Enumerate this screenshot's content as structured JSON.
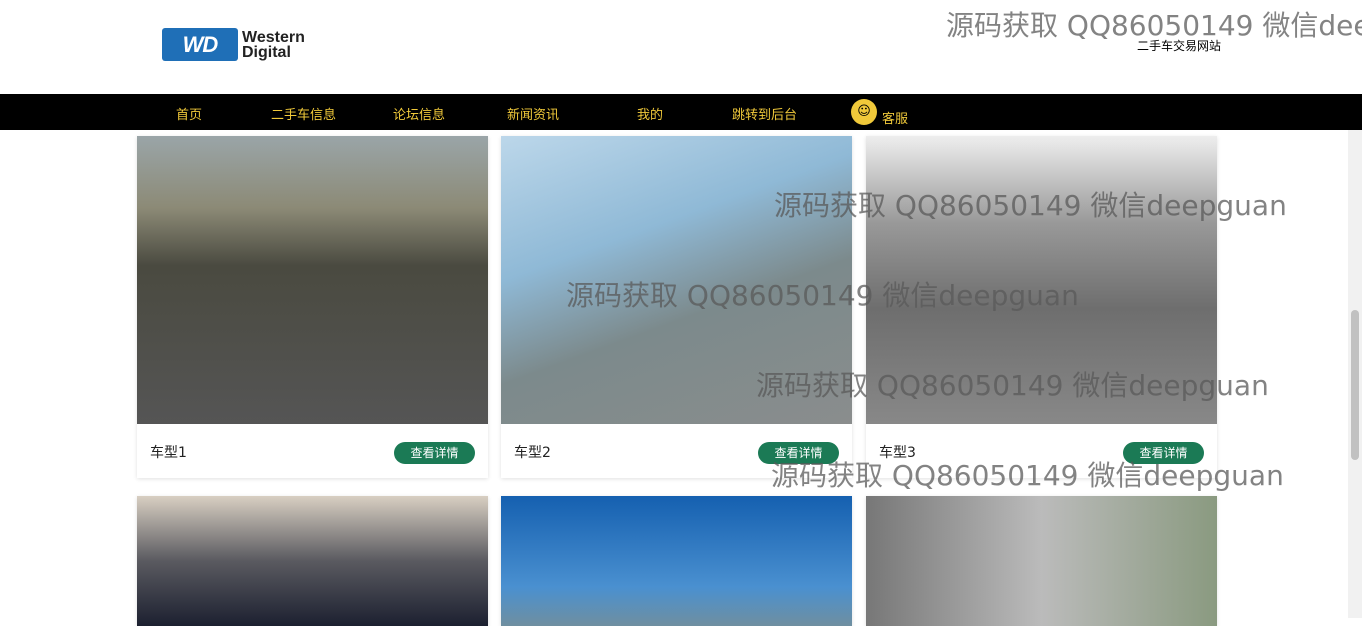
{
  "header": {
    "logo_abbr": "WD",
    "logo_line1": "Western",
    "logo_line2": "Digital",
    "site_name": "二手车交易网站"
  },
  "nav": {
    "items": [
      "首页",
      "二手车信息",
      "论坛信息",
      "新闻资讯",
      "我的",
      "跳转到后台"
    ],
    "service": "客服"
  },
  "cards": [
    {
      "title": "车型1",
      "button": "查看详情"
    },
    {
      "title": "车型2",
      "button": "查看详情"
    },
    {
      "title": "车型3",
      "button": "查看详情"
    }
  ],
  "watermark": "源码获取 QQ86050149 微信deepguan",
  "colors": {
    "nav_bg": "#000000",
    "nav_text": "#f0c93a",
    "button": "#1b7a55"
  }
}
